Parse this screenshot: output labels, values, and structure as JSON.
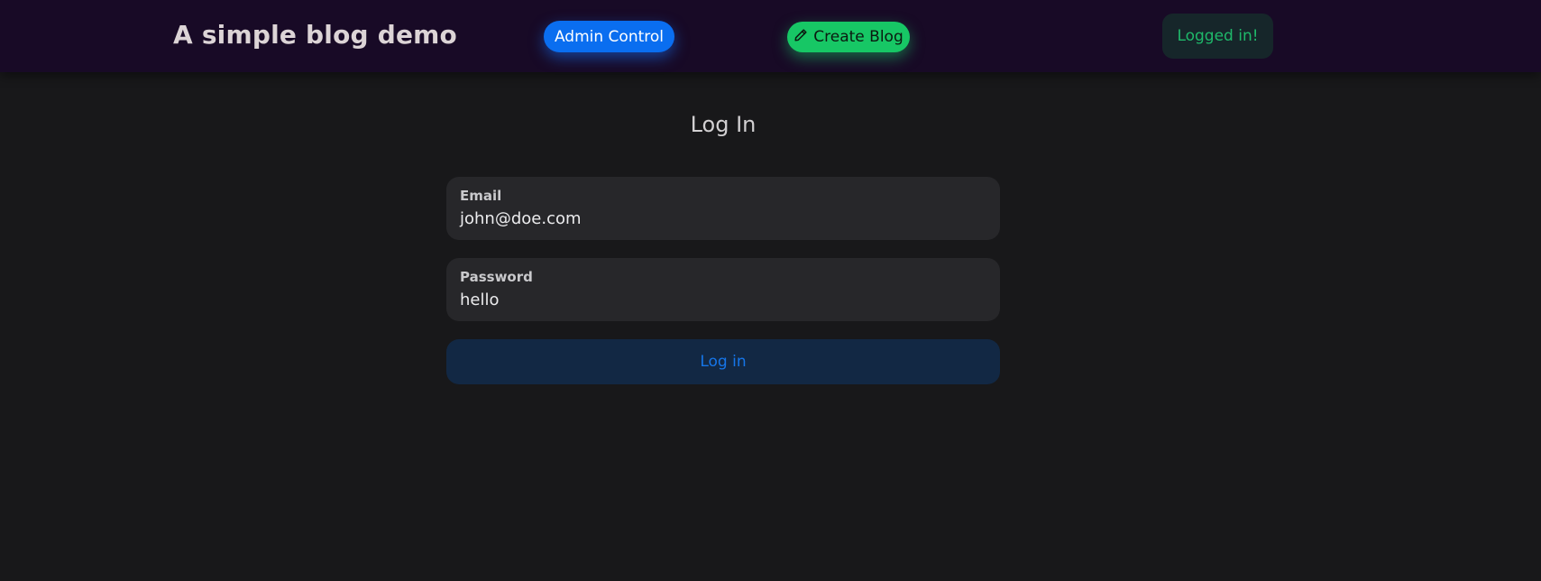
{
  "header": {
    "brand": "A simple blog demo",
    "admin_button": "Admin Control",
    "create_button": "Create Blog",
    "create_icon": "pencil-icon",
    "status": "Logged in!"
  },
  "main": {
    "title": "Log In",
    "email": {
      "label": "Email",
      "value": "john@doe.com"
    },
    "password": {
      "label": "Password",
      "value": "hello"
    },
    "submit_label": "Log in"
  },
  "colors": {
    "navbar_bg": "#180a26",
    "page_bg": "#18181a",
    "admin_accent": "#0a6ef0",
    "create_accent": "#17c765",
    "status_text": "#1fb86a",
    "submit_text": "#1675e8"
  }
}
